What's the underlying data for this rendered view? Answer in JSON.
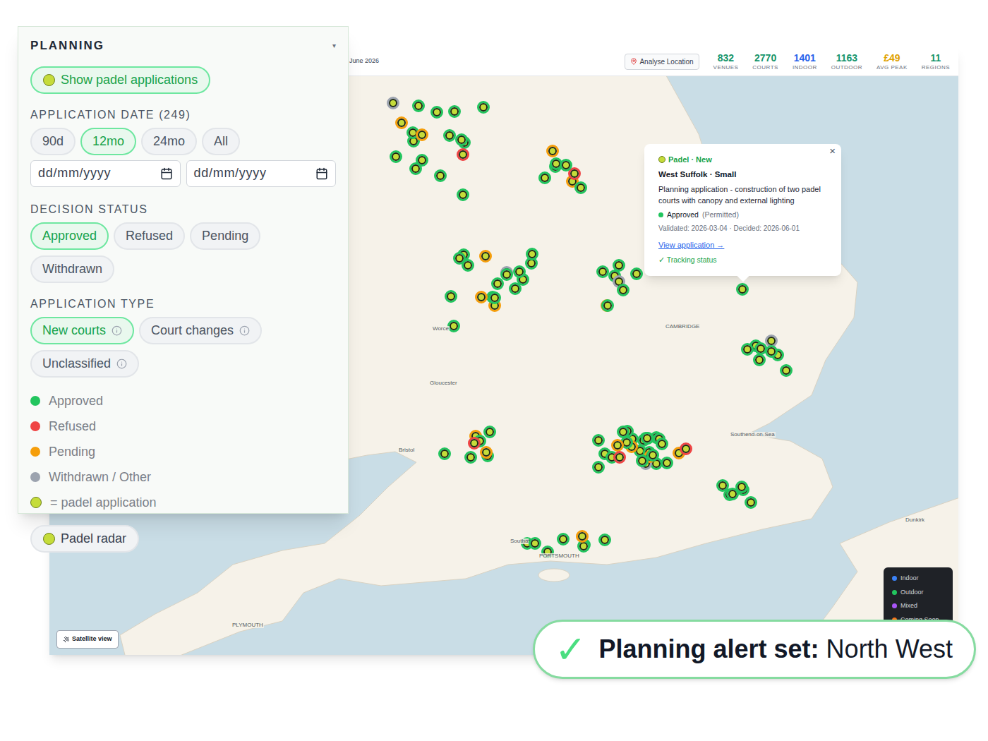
{
  "planning_panel": {
    "title": "PLANNING",
    "collapse_icon": "▾",
    "padel_toggle": {
      "label": "Show padel applications",
      "selected": true
    },
    "date_section": {
      "heading": "APPLICATION DATE (249)",
      "ranges": [
        {
          "label": "90d",
          "selected": false
        },
        {
          "label": "12mo",
          "selected": true
        },
        {
          "label": "24mo",
          "selected": false
        },
        {
          "label": "All",
          "selected": false
        }
      ],
      "date_inputs": [
        {
          "placeholder": "dd/mm/yyyy"
        },
        {
          "placeholder": "dd/mm/yyyy"
        }
      ]
    },
    "decision_section": {
      "heading": "DECISION STATUS",
      "options": [
        {
          "label": "Approved",
          "selected": true
        },
        {
          "label": "Refused",
          "selected": false
        },
        {
          "label": "Pending",
          "selected": false
        },
        {
          "label": "Withdrawn",
          "selected": false
        }
      ]
    },
    "type_section": {
      "heading": "APPLICATION TYPE",
      "options": [
        {
          "label": "New courts",
          "selected": true
        },
        {
          "label": "Court changes",
          "selected": false
        },
        {
          "label": "Unclassified",
          "selected": false
        }
      ]
    },
    "legend": [
      {
        "label": "Approved",
        "kind": "dot",
        "color": "#22c55e"
      },
      {
        "label": "Refused",
        "kind": "dot",
        "color": "#ef4444"
      },
      {
        "label": "Pending",
        "kind": "dot",
        "color": "#f59e0b"
      },
      {
        "label": "Withdrawn / Other",
        "kind": "dot",
        "color": "#9ca3af"
      },
      {
        "label": "= padel application",
        "kind": "ball",
        "color": "#c5dc3a"
      }
    ],
    "radar_button": {
      "label": "Padel radar"
    }
  },
  "map": {
    "date_text": "June 2026",
    "analyse_button": "Analyse Location",
    "stats": [
      {
        "value": "832",
        "label": "VENUES",
        "color": "#15956b"
      },
      {
        "value": "2770",
        "label": "COURTS",
        "color": "#15956b"
      },
      {
        "value": "1401",
        "label": "INDOOR",
        "color": "#2563eb"
      },
      {
        "value": "1163",
        "label": "OUTDOOR",
        "color": "#15956b"
      },
      {
        "value": "£49",
        "label": "AVG PEAK",
        "color": "#e0a100"
      },
      {
        "value": "11",
        "label": "REGIONS",
        "color": "#15956b"
      }
    ],
    "labels": [
      {
        "text": "Bristol"
      },
      {
        "text": "Gloucester"
      },
      {
        "text": "Worce"
      },
      {
        "text": "CAMBRIDGE"
      },
      {
        "text": "Southend-on-Sea"
      },
      {
        "text": "PORTSMOUTH"
      },
      {
        "text": "PLYMOUTH"
      },
      {
        "text": "Dunkirk"
      },
      {
        "text": "Southa"
      }
    ],
    "pins": [
      {
        "color": "#22c55e"
      },
      {
        "color": "#22c55e"
      },
      {
        "color": "#f59e0b"
      },
      {
        "color": "#22c55e"
      },
      {
        "color": "#22c55e"
      },
      {
        "color": "#22c55e"
      },
      {
        "color": "#ef4444"
      },
      {
        "color": "#22c55e"
      },
      {
        "color": "#22c55e"
      },
      {
        "color": "#f59e0b"
      },
      {
        "color": "#22c55e"
      },
      {
        "color": "#22c55e"
      },
      {
        "color": "#22c55e"
      },
      {
        "color": "#9ca3af"
      },
      {
        "color": "#22c55e"
      },
      {
        "color": "#f59e0b"
      },
      {
        "color": "#22c55e"
      },
      {
        "color": "#22c55e"
      },
      {
        "color": "#22c55e"
      },
      {
        "color": "#22c55e"
      },
      {
        "color": "#f59e0b"
      },
      {
        "color": "#22c55e"
      },
      {
        "color": "#22c55e"
      },
      {
        "color": "#22c55e"
      },
      {
        "color": "#ef4444"
      },
      {
        "color": "#22c55e"
      },
      {
        "color": "#22c55e"
      },
      {
        "color": "#22c55e"
      },
      {
        "color": "#f59e0b"
      },
      {
        "color": "#22c55e"
      },
      {
        "color": "#22c55e"
      },
      {
        "color": "#22c55e"
      },
      {
        "color": "#9ca3af"
      },
      {
        "color": "#22c55e"
      },
      {
        "color": "#22c55e"
      },
      {
        "color": "#22c55e"
      },
      {
        "color": "#f59e0b"
      },
      {
        "color": "#22c55e"
      },
      {
        "color": "#22c55e"
      },
      {
        "color": "#22c55e"
      },
      {
        "color": "#22c55e"
      },
      {
        "color": "#f59e0b"
      },
      {
        "color": "#22c55e"
      },
      {
        "color": "#22c55e"
      },
      {
        "color": "#22c55e"
      },
      {
        "color": "#22c55e"
      },
      {
        "color": "#22c55e"
      },
      {
        "color": "#ef4444"
      },
      {
        "color": "#22c55e"
      },
      {
        "color": "#22c55e"
      },
      {
        "color": "#22c55e"
      },
      {
        "color": "#22c55e"
      },
      {
        "color": "#22c55e"
      },
      {
        "color": "#f59e0b"
      },
      {
        "color": "#22c55e"
      },
      {
        "color": "#22c55e"
      },
      {
        "color": "#9ca3af"
      },
      {
        "color": "#22c55e"
      },
      {
        "color": "#22c55e"
      },
      {
        "color": "#f59e0b"
      },
      {
        "color": "#22c55e"
      },
      {
        "color": "#22c55e"
      },
      {
        "color": "#22c55e"
      },
      {
        "color": "#22c55e"
      },
      {
        "color": "#f59e0b"
      },
      {
        "color": "#22c55e"
      },
      {
        "color": "#22c55e"
      },
      {
        "color": "#22c55e"
      },
      {
        "color": "#ef4444"
      },
      {
        "color": "#22c55e"
      },
      {
        "color": "#f59e0b"
      },
      {
        "color": "#22c55e"
      },
      {
        "color": "#22c55e"
      },
      {
        "color": "#22c55e"
      },
      {
        "color": "#22c55e"
      },
      {
        "color": "#22c55e"
      },
      {
        "color": "#9ca3af"
      },
      {
        "color": "#22c55e"
      },
      {
        "color": "#22c55e"
      },
      {
        "color": "#22c55e"
      },
      {
        "color": "#22c55e"
      },
      {
        "color": "#22c55e"
      },
      {
        "color": "#f59e0b"
      },
      {
        "color": "#22c55e"
      },
      {
        "color": "#22c55e"
      },
      {
        "color": "#22c55e"
      },
      {
        "color": "#22c55e"
      },
      {
        "color": "#22c55e"
      },
      {
        "color": "#f59e0b"
      },
      {
        "color": "#22c55e"
      },
      {
        "color": "#22c55e"
      },
      {
        "color": "#ef4444"
      },
      {
        "color": "#22c55e"
      },
      {
        "color": "#22c55e"
      },
      {
        "color": "#22c55e"
      },
      {
        "color": "#f59e0b"
      },
      {
        "color": "#22c55e"
      },
      {
        "color": "#22c55e"
      },
      {
        "color": "#22c55e"
      },
      {
        "color": "#22c55e"
      },
      {
        "color": "#22c55e"
      },
      {
        "color": "#22c55e"
      },
      {
        "color": "#22c55e"
      },
      {
        "color": "#f59e0b"
      },
      {
        "color": "#22c55e"
      },
      {
        "color": "#22c55e"
      },
      {
        "color": "#22c55e"
      },
      {
        "color": "#9ca3af"
      },
      {
        "color": "#22c55e"
      },
      {
        "color": "#22c55e"
      }
    ],
    "popup": {
      "close": "×",
      "tag": "Padel · New",
      "title": "West Suffolk · Small",
      "description": "Planning application - construction of two padel courts with canopy and external lighting",
      "status": "Approved",
      "status_detail": "(Permitted)",
      "status_color": "#22c55e",
      "dates": "Validated: 2026-03-04 · Decided: 2026-06-01",
      "link": "View application →",
      "tracking": "✓ Tracking status"
    },
    "type_legend": [
      {
        "label": "Indoor",
        "color": "#3b82f6"
      },
      {
        "label": "Outdoor",
        "color": "#22c55e"
      },
      {
        "label": "Mixed",
        "color": "#a855f7"
      },
      {
        "label": "Coming Soon",
        "color": "#f97316"
      }
    ],
    "satellite_button": "Satellite view"
  },
  "toast": {
    "icon": "✓",
    "bold": "Planning alert set:",
    "text": "North West"
  }
}
